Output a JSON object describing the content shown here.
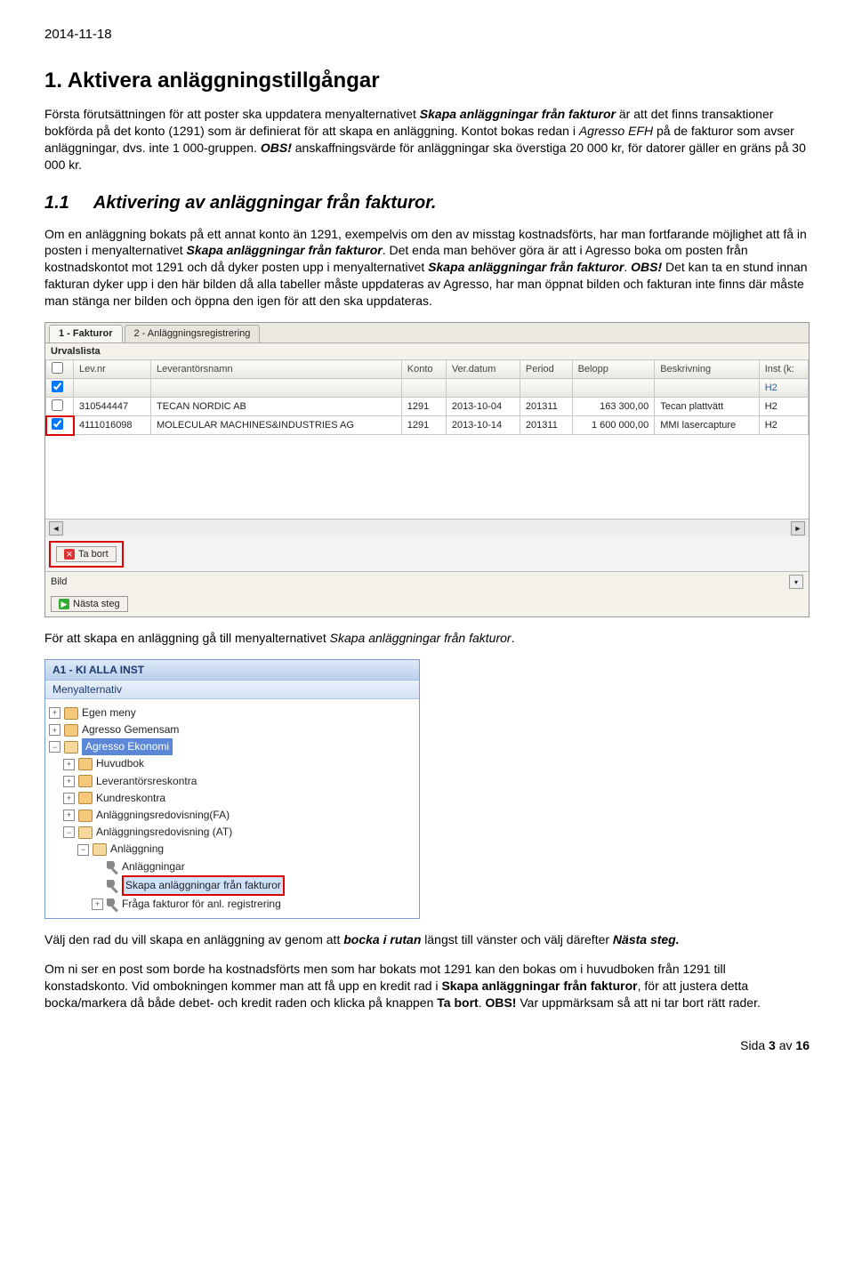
{
  "date": "2014-11-18",
  "h1": "1. Aktivera anläggningstillgångar",
  "p1a": "Första förutsättningen för att poster ska uppdatera menyalternativet ",
  "p1b_em": "Skapa anläggningar från fakturor",
  "p1c": " är att det finns transaktioner bokförda på det konto (1291) som är definierat för att skapa en anläggning. Kontot bokas redan i ",
  "p1d_em": "Agresso EFH",
  "p1e": " på de fakturor som avser anläggningar, dvs. inte 1 000-gruppen. ",
  "p1f_bold": "OBS!",
  "p1g": " anskaffningsvärde för anläggningar ska överstiga 20 000 kr, för datorer gäller en gräns på 30 000 kr.",
  "h2num": "1.1",
  "h2": "Aktivering av anläggningar från fakturor.",
  "p2a": "Om en anläggning bokats på ett annat konto än 1291, exempelvis om den av misstag kostnadsförts, har man fortfarande möjlighet att få in posten i menyalternativet ",
  "p2b_em": "Skapa anläggningar från fakturor",
  "p2c": ". Det enda man behöver göra är att i Agresso boka om posten från kostnadskontot mot 1291 och då dyker posten upp i menyalternativet ",
  "p2d_em": "Skapa anläggningar från fakturor",
  "p2e": ". ",
  "p2f_bold": "OBS!",
  "p2g": " Det kan ta en stund innan fakturan dyker upp i den här bilden då alla tabeller måste uppdateras av Agresso, har man öppnat bilden och fakturan inte finns där måste man stänga ner bilden och öppna den igen för att den ska uppdateras.",
  "shot1": {
    "tab1": "1 - Fakturor",
    "tab2": "2 - Anläggningsregistrering",
    "urval": "Urvalslista",
    "headers": [
      "",
      "Lev.nr",
      "Leverantörsnamn",
      "Konto",
      "Ver.datum",
      "Period",
      "Belopp",
      "Beskrivning",
      "Inst (k:"
    ],
    "h2cell": "H2",
    "rows": [
      {
        "chk": "",
        "lev": "310544447",
        "namn": "TECAN NORDIC AB",
        "konto": "1291",
        "dat": "2013-10-04",
        "per": "201311",
        "bel": "163 300,00",
        "besk": "Tecan plattvätt",
        "inst": "H2"
      },
      {
        "chk": "✓",
        "lev": "4111016098",
        "namn": "MOLECULAR MACHINES&INDUSTRIES AG",
        "konto": "1291",
        "dat": "2013-10-14",
        "per": "201311",
        "bel": "1 600 000,00",
        "besk": "MMI lasercapture",
        "inst": "H2"
      }
    ],
    "tabort": "Ta bort",
    "bild": "Bild",
    "nasta": "Nästa steg"
  },
  "p3a": "För att skapa en anläggning gå till menyalternativet ",
  "p3b_em": "Skapa anläggningar från fakturor",
  "p3c": ".",
  "shot2": {
    "title": "A1 - KI ALLA INST",
    "sub": "Menyalternativ",
    "nodes": [
      {
        "ind": 0,
        "pm": "+",
        "type": "folder",
        "label": "Egen meny"
      },
      {
        "ind": 0,
        "pm": "+",
        "type": "folder",
        "label": "Agresso Gemensam"
      },
      {
        "ind": 0,
        "pm": "−",
        "type": "folder-open",
        "label": "Agresso Ekonomi",
        "sel": "blue"
      },
      {
        "ind": 1,
        "pm": "+",
        "type": "folder",
        "label": "Huvudbok"
      },
      {
        "ind": 1,
        "pm": "+",
        "type": "folder",
        "label": "Leverantörsreskontra"
      },
      {
        "ind": 1,
        "pm": "+",
        "type": "folder",
        "label": "Kundreskontra"
      },
      {
        "ind": 1,
        "pm": "+",
        "type": "folder",
        "label": "Anläggningsredovisning(FA)"
      },
      {
        "ind": 1,
        "pm": "−",
        "type": "folder-open",
        "label": "Anläggningsredovisning (AT)"
      },
      {
        "ind": 2,
        "pm": "−",
        "type": "folder-open",
        "label": "Anläggning"
      },
      {
        "ind": 3,
        "pm": "",
        "type": "wrench",
        "label": "Anläggningar"
      },
      {
        "ind": 3,
        "pm": "",
        "type": "wrench",
        "label": "Skapa anläggningar från fakturor",
        "sel": "red"
      },
      {
        "ind": 3,
        "pm": "+",
        "type": "wrench",
        "label": "Fråga fakturor för anl. registrering"
      }
    ]
  },
  "p4a": "Välj den rad du vill skapa en anläggning av genom att ",
  "p4b_bold": "bocka i rutan",
  "p4c": " längst till vänster och välj därefter ",
  "p4d_bold": "Nästa steg.",
  "p5a": "Om ni ser en post som borde ha kostnadsförts men som har bokats mot 1291 kan den bokas om i huvudboken från 1291 till konstadskonto. Vid ombokningen kommer man att få upp en kredit rad i ",
  "p5b_bold": "Skapa anläggningar från fakturor",
  "p5c": ", för att justera detta bocka/markera då både debet- och kredit raden och klicka på knappen ",
  "p5d_bold": "Ta bort",
  "p5e": ". ",
  "p5f_bold": "OBS!",
  "p5g": " Var uppmärksam så att ni tar bort rätt rader.",
  "footer_a": "Sida ",
  "footer_b": "3",
  "footer_c": " av ",
  "footer_d": "16"
}
